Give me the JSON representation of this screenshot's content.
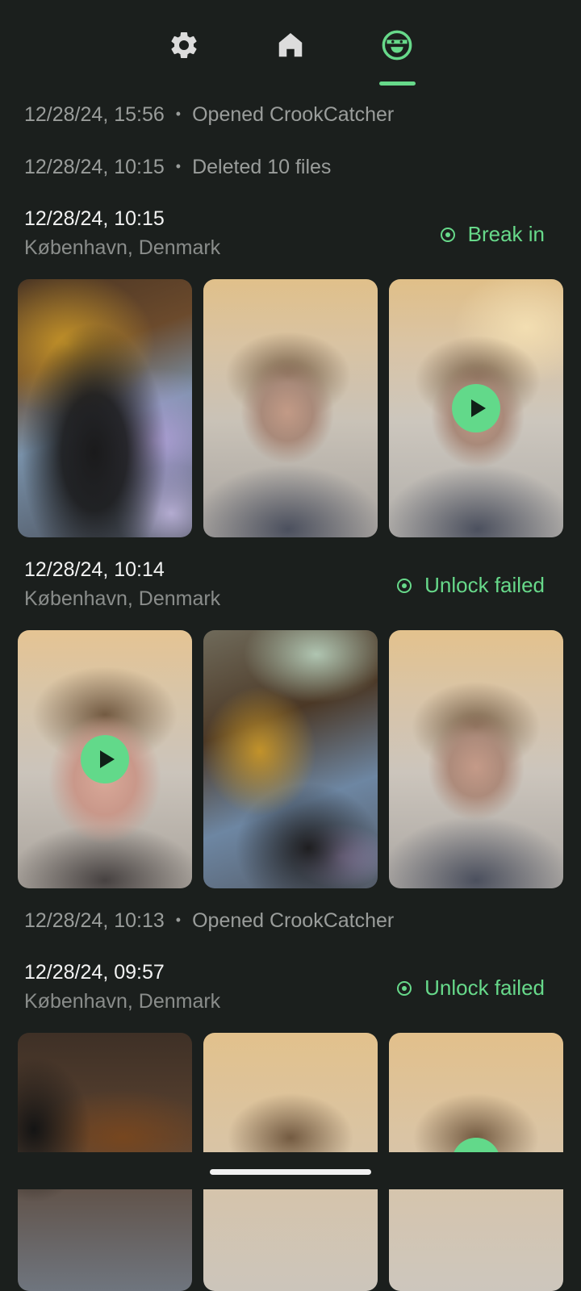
{
  "nav": {
    "tabs": [
      {
        "name": "settings",
        "icon": "gear-icon"
      },
      {
        "name": "home",
        "icon": "home-icon"
      },
      {
        "name": "crook",
        "icon": "masked-face-icon",
        "active": true
      }
    ],
    "accent": "#67d98a"
  },
  "logs": [
    {
      "time": "12/28/24, 15:56",
      "sep": "•",
      "text": "Opened CrookCatcher"
    },
    {
      "time": "12/28/24, 10:15",
      "sep": "•",
      "text": "Deleted 10 files"
    },
    {
      "time": "12/28/24, 10:13",
      "sep": "•",
      "text": "Opened CrookCatcher"
    }
  ],
  "events": [
    {
      "time": "12/28/24, 10:15",
      "location": "København, Denmark",
      "type": "Break in"
    },
    {
      "time": "12/28/24, 10:14",
      "location": "København, Denmark",
      "type": "Unlock failed"
    },
    {
      "time": "12/28/24, 09:57",
      "location": "København, Denmark",
      "type": "Unlock failed"
    }
  ]
}
